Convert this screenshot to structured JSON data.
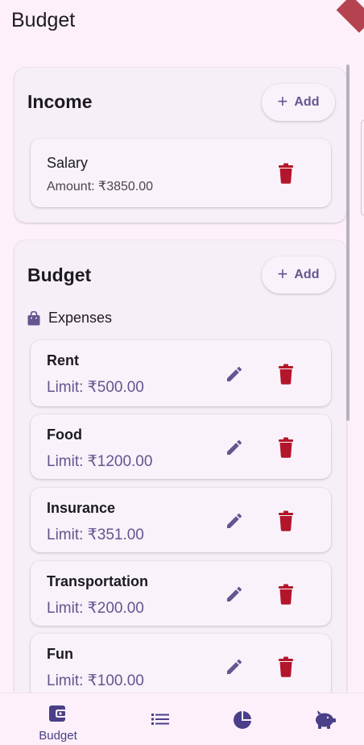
{
  "app": {
    "title": "Budget"
  },
  "income": {
    "title": "Income",
    "add_label": "Add",
    "items": [
      {
        "name": "Salary",
        "amount": "Amount: ₹3850.00"
      }
    ]
  },
  "budget": {
    "title": "Budget",
    "add_label": "Add",
    "category": {
      "label": "Expenses",
      "icon": "shopping-bag-icon"
    },
    "items": [
      {
        "name": "Rent",
        "limit": "Limit: ₹500.00"
      },
      {
        "name": "Food",
        "limit": "Limit: ₹1200.00"
      },
      {
        "name": "Insurance",
        "limit": "Limit: ₹351.00"
      },
      {
        "name": "Transportation",
        "limit": "Limit: ₹200.00"
      },
      {
        "name": "Fun",
        "limit": "Limit: ₹100.00"
      }
    ]
  },
  "bottom_nav": {
    "items": [
      {
        "label": "Budget",
        "icon": "wallet-icon",
        "selected": true
      },
      {
        "label": "",
        "icon": "list-icon",
        "selected": false
      },
      {
        "label": "",
        "icon": "pie-chart-icon",
        "selected": false
      },
      {
        "label": "",
        "icon": "piggy-bank-icon",
        "selected": false
      }
    ]
  },
  "colors": {
    "background": "#fdf0fb",
    "accent": "#65558f",
    "danger": "#b3162b",
    "nav_icon": "#4a3f88"
  }
}
